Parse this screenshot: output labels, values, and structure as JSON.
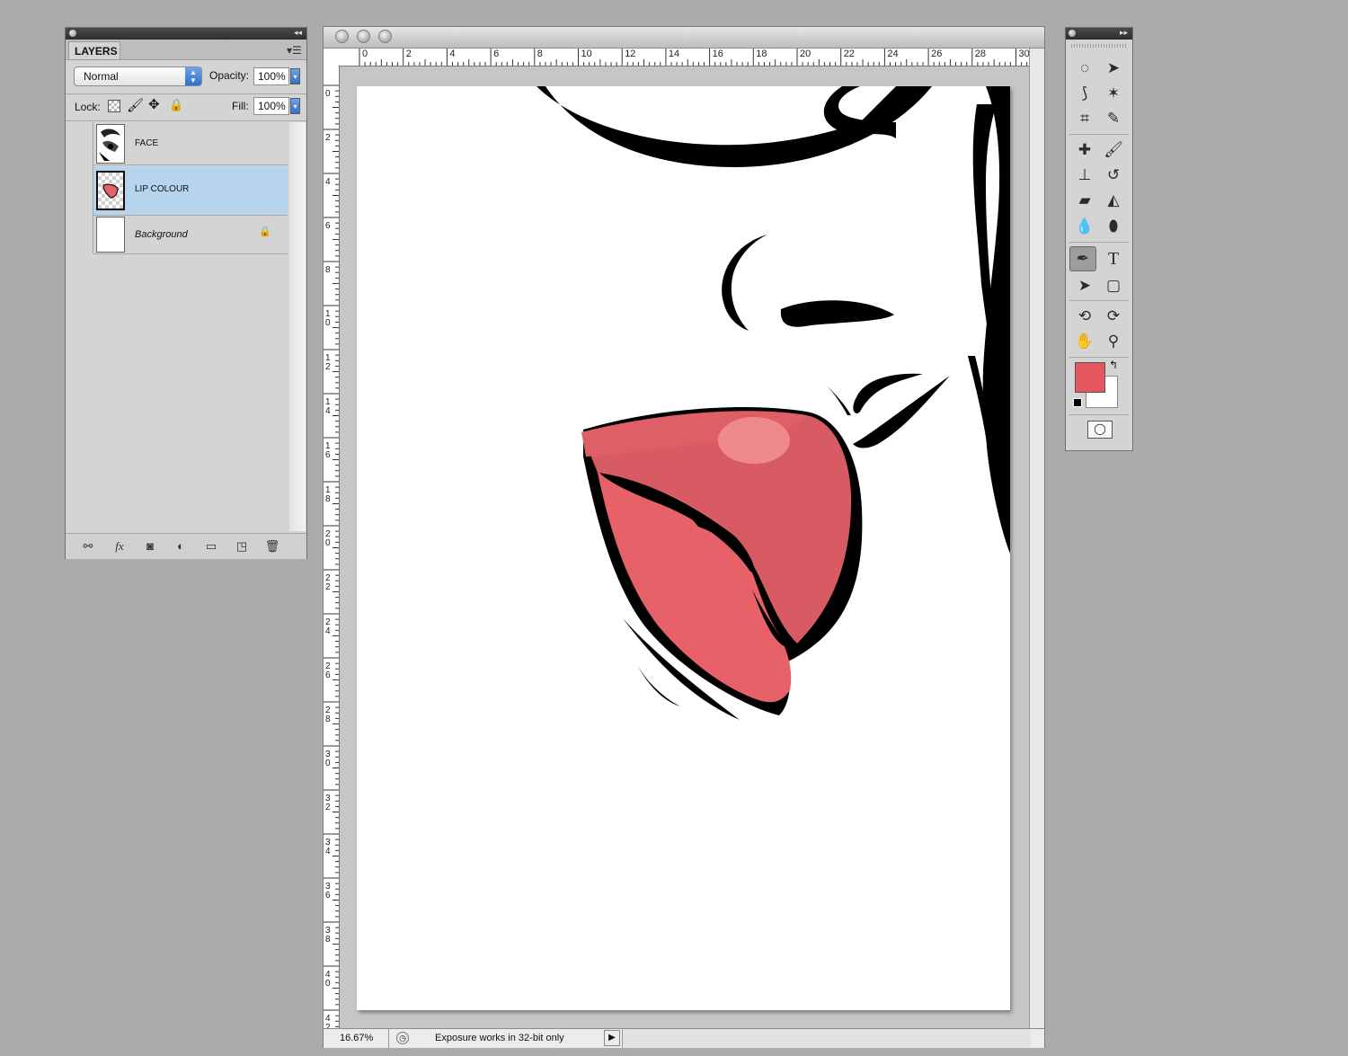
{
  "layers_panel": {
    "tab_label": "LAYERS",
    "blend_mode": "Normal",
    "opacity_label": "Opacity:",
    "opacity_value": "100%",
    "lock_label": "Lock:",
    "fill_label": "Fill:",
    "fill_value": "100%",
    "layers": [
      {
        "name": "FACE",
        "selected": false
      },
      {
        "name": "LIP COLOUR",
        "selected": true
      },
      {
        "name": "Background",
        "selected": false,
        "locked": true
      }
    ],
    "footer_icons": [
      "link-icon",
      "fx-icon",
      "mask-icon",
      "adjustment-icon",
      "folder-icon",
      "new-layer-icon",
      "trash-icon"
    ],
    "fx_label": "fx"
  },
  "document": {
    "ruler_top": [
      "0",
      "2",
      "4",
      "6",
      "8",
      "10",
      "12",
      "14",
      "16",
      "18",
      "20",
      "22",
      "24",
      "26",
      "28",
      "30"
    ],
    "ruler_left": [
      "0",
      "2",
      "4",
      "6",
      "8",
      "10",
      "12",
      "14",
      "16",
      "18",
      "20",
      "22",
      "24",
      "26",
      "28",
      "30",
      "32",
      "34",
      "36",
      "38",
      "40",
      "42"
    ],
    "zoom": "16.67%",
    "status_text": "Exposure works in 32-bit only",
    "lip_color": "#e66268",
    "lip_shade": "#d85b63"
  },
  "tools_panel": {
    "foreground_color": "#e5575f",
    "background_color": "#ffffff",
    "tools": [
      "marquee-icon",
      "move-icon",
      "lasso-icon",
      "magic-wand-icon",
      "crop-icon",
      "eyedropper-icon",
      "healing-brush-icon",
      "brush-icon",
      "clone-stamp-icon",
      "history-brush-icon",
      "eraser-icon",
      "paint-bucket-icon",
      "blur-icon",
      "dodge-icon",
      "pen-icon",
      "type-icon",
      "path-selection-icon",
      "shape-icon",
      "3d-rotate-icon",
      "3d-orbit-icon",
      "hand-icon",
      "zoom-icon"
    ],
    "active_tool": "pen-icon",
    "type_glyph": "T"
  }
}
